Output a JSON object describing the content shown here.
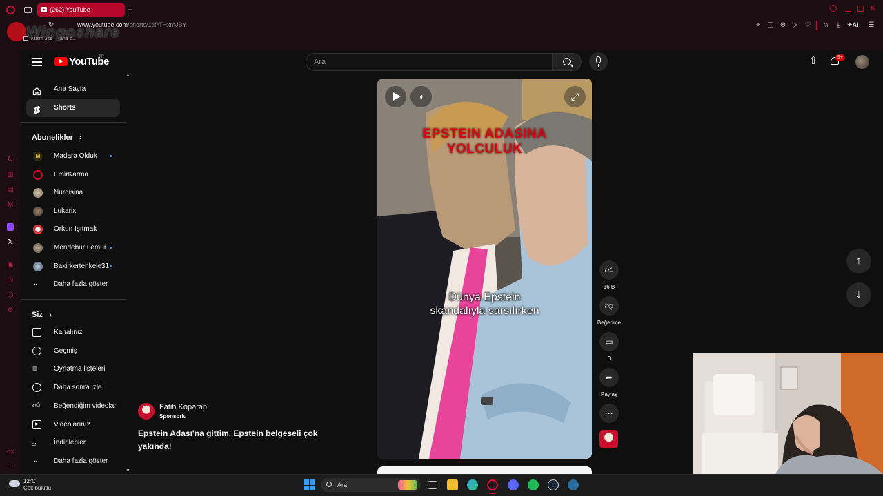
{
  "browser": {
    "tab_title": "(262) YouTube",
    "url_domain": "www.youtube.com",
    "url_path": "/shorts/1tiPTHxmJBY",
    "tooltip": "Kusm 3se — ana s...",
    "watermark": "Wingoshare",
    "ai_label": "AI"
  },
  "header": {
    "logo_text": "YouTube",
    "region": "TR",
    "search_placeholder": "Ara",
    "notifications_badge": "9+"
  },
  "sidebar": {
    "main": [
      {
        "label": "Ana Sayfa",
        "icon": "home-icon"
      },
      {
        "label": "Shorts",
        "icon": "shorts-icon",
        "active": true
      }
    ],
    "subscriptions_title": "Abonelikler",
    "subscriptions": [
      {
        "label": "Madara Olduk",
        "color": "#e6c32a",
        "new": true
      },
      {
        "label": "EmirKarma",
        "color": "#c8102e",
        "new": false
      },
      {
        "label": "Nurdisina",
        "color": "#a89a82",
        "new": false
      },
      {
        "label": "Lukarix",
        "color": "#6b5a48",
        "new": false
      },
      {
        "label": "Orkun Işıtmak",
        "color": "#d13a3a",
        "new": false
      },
      {
        "label": "Mendebur Lemur",
        "color": "#8c7a6a",
        "new": true
      },
      {
        "label": "Bakirkertenkele31",
        "color": "#7a8fa8",
        "new": true
      }
    ],
    "subscriptions_more": "Daha fazla göster",
    "you_title": "Siz",
    "you": [
      {
        "label": "Kanalınız",
        "icon": "channel-icon"
      },
      {
        "label": "Geçmiş",
        "icon": "history-icon"
      },
      {
        "label": "Oynatma listeleri",
        "icon": "playlist-icon"
      },
      {
        "label": "Daha sonra izle",
        "icon": "watch-later-icon"
      },
      {
        "label": "Beğendiğim videolar",
        "icon": "liked-icon"
      },
      {
        "label": "Videolarınız",
        "icon": "your-videos-icon"
      },
      {
        "label": "İndirilenler",
        "icon": "download-icon"
      }
    ],
    "you_more": "Daha fazla göster"
  },
  "short": {
    "overlay_title_1": "EPSTEIN ADASINA",
    "overlay_title_2": "YOLCULUK",
    "subtitle_1": "Dünya Epstein",
    "subtitle_2": "skandalıyla sarsılırken",
    "channel_name": "Fatih Koparan",
    "sponsored": "Sponsorlu",
    "description_1": "Epstein Adası'na gittim. Epstein belgeseli çok",
    "description_2": "yakında!",
    "likes": "16 B",
    "dislike_label": "Beğenme",
    "comments": "0",
    "share_label": "Paylaş"
  },
  "taskbar": {
    "temperature": "12°C",
    "weather": "Çok bulutlu",
    "search_placeholder": "Ara"
  },
  "colors": {
    "yt_red": "#ff0000",
    "opera_red": "#b6072a",
    "bg": "#0f0f0f",
    "chip": "#272727"
  }
}
